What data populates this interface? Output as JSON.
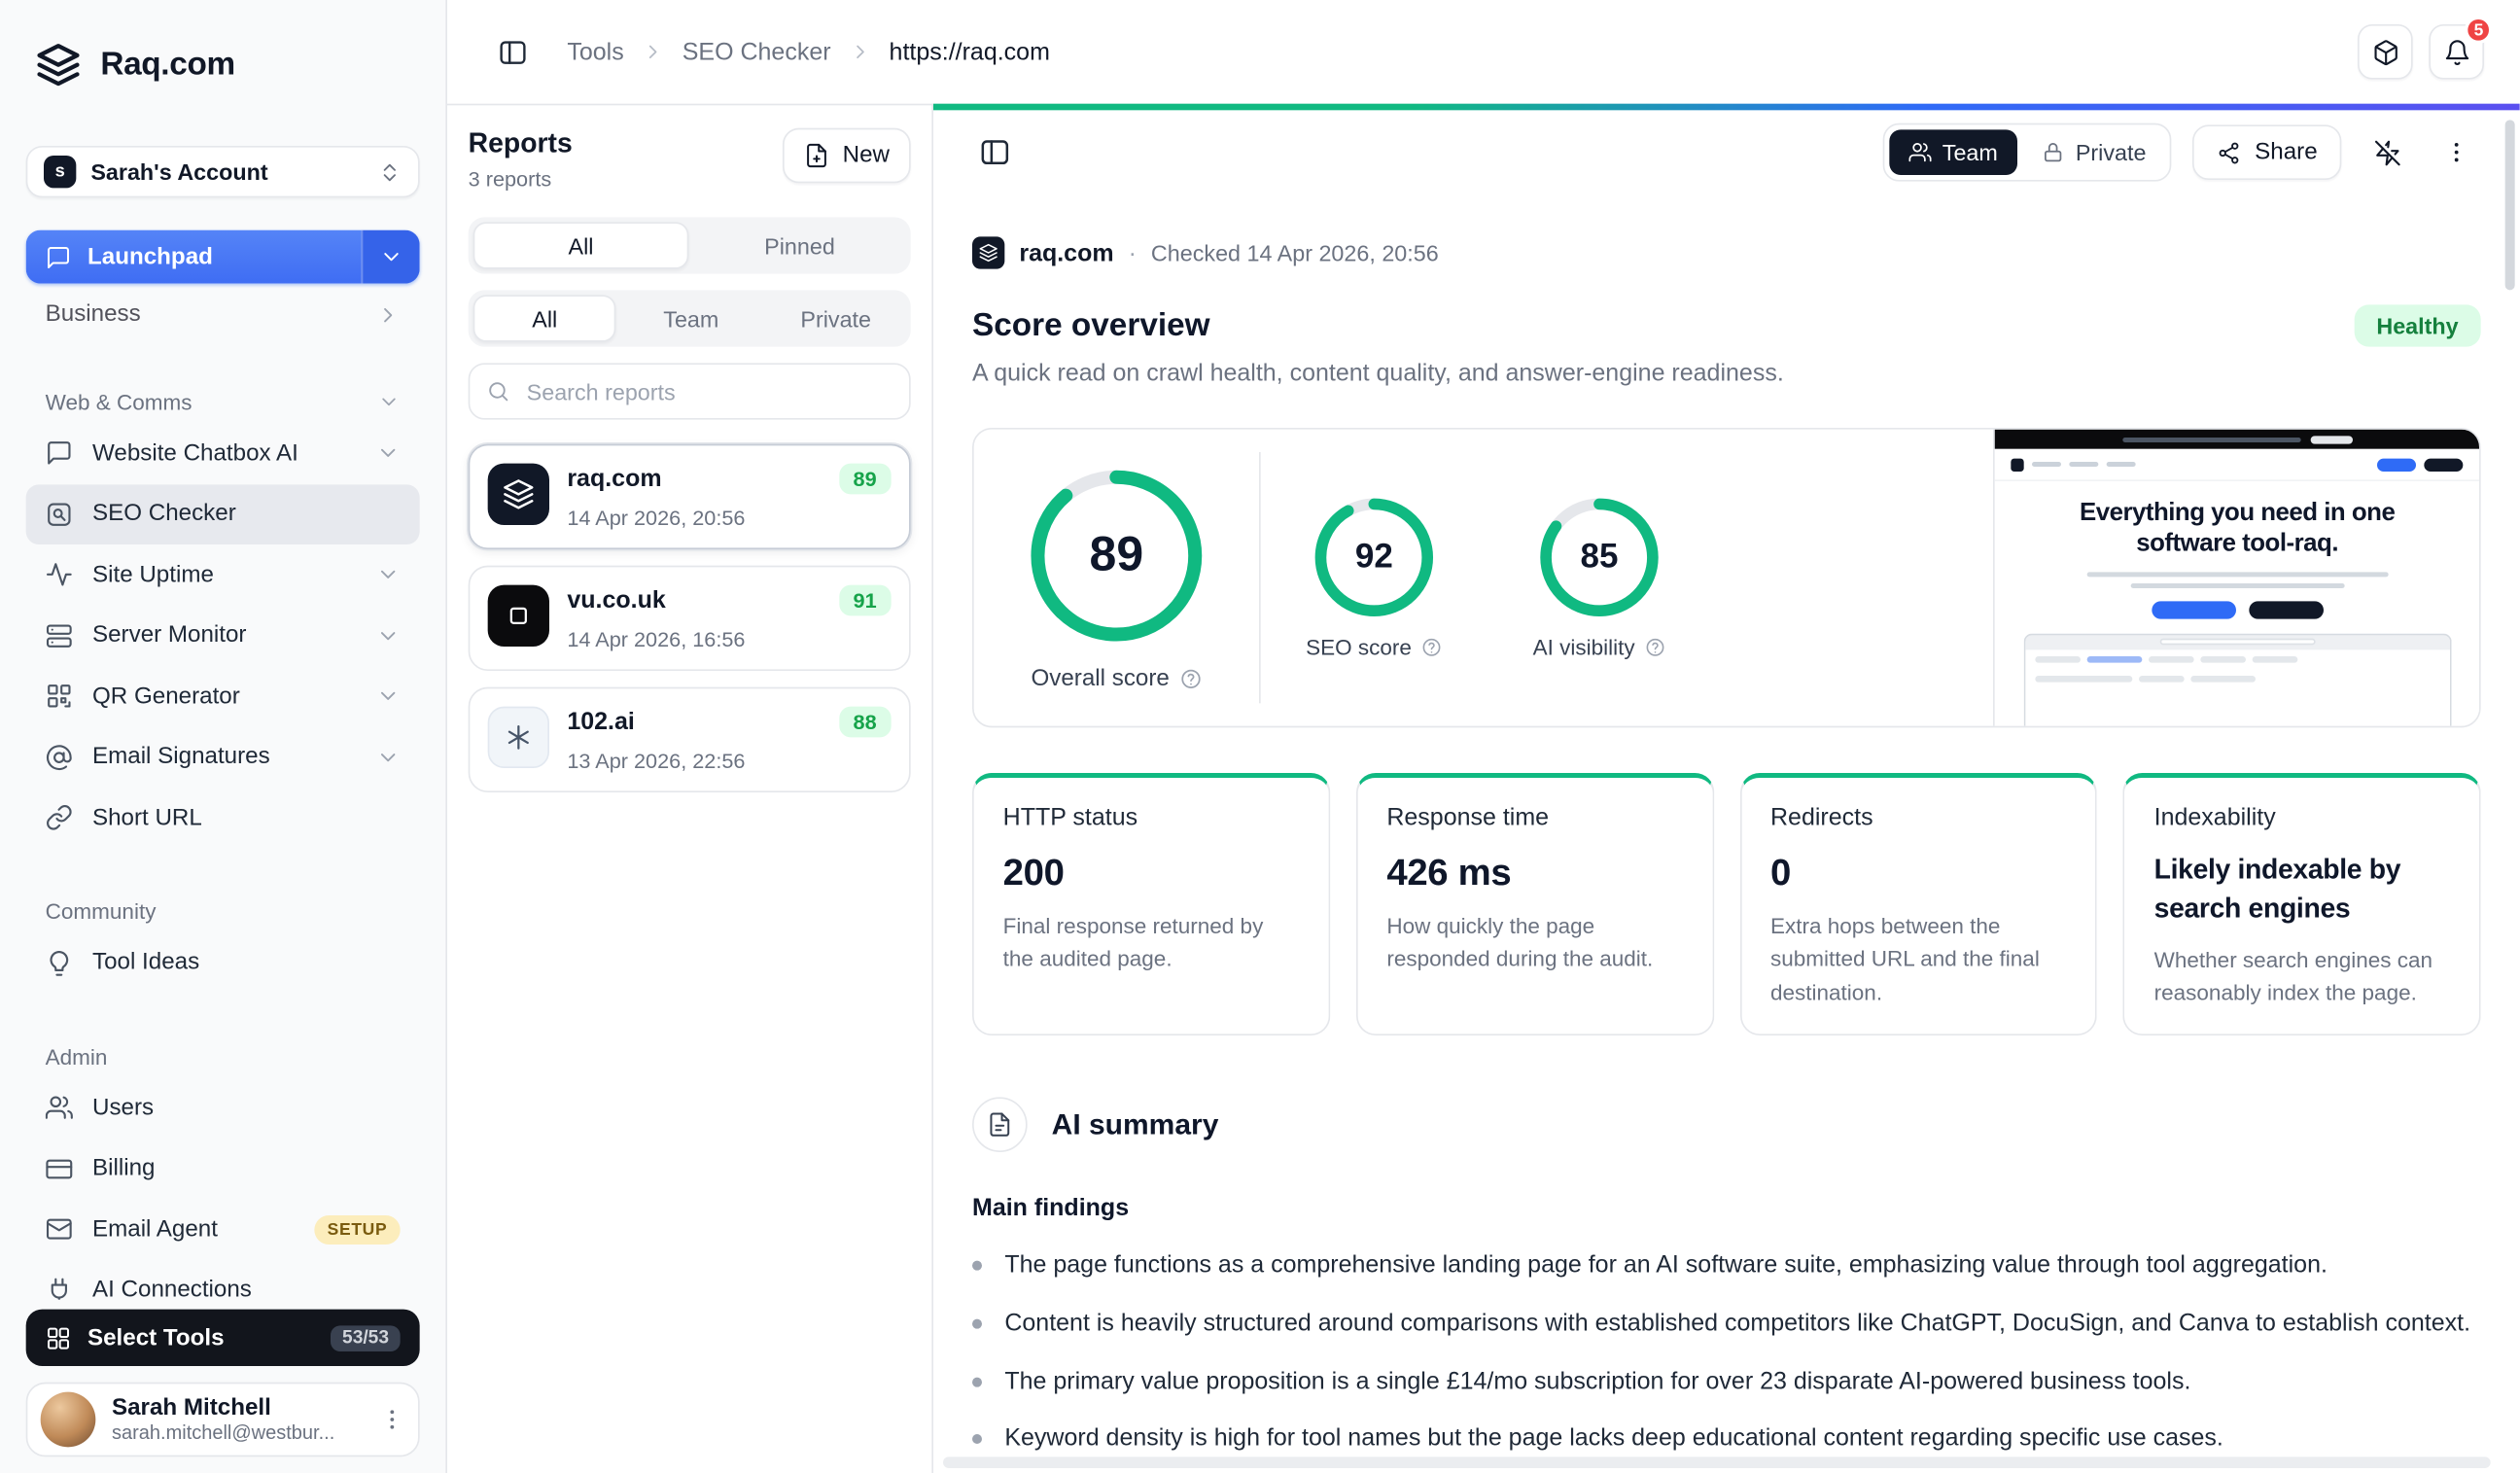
{
  "brand": {
    "name": "Raq.com"
  },
  "sidebar": {
    "account": {
      "initial": "s",
      "name": "Sarah's Account"
    },
    "launchpad_label": "Launchpad",
    "business_label": "Business",
    "sections": {
      "web_comms": "Web & Comms",
      "community": "Community",
      "admin": "Admin"
    },
    "tools": [
      {
        "label": "Website Chatbox AI",
        "icon": "chat-icon"
      },
      {
        "label": "SEO Checker",
        "icon": "seo-search-icon"
      },
      {
        "label": "Site Uptime",
        "icon": "pulse-icon"
      },
      {
        "label": "Server Monitor",
        "icon": "server-icon"
      },
      {
        "label": "QR Generator",
        "icon": "qr-icon"
      },
      {
        "label": "Email Signatures",
        "icon": "at-sign-icon"
      },
      {
        "label": "Short URL",
        "icon": "link-icon"
      }
    ],
    "community_items": [
      {
        "label": "Tool Ideas",
        "icon": "lightbulb-icon"
      }
    ],
    "admin_items": [
      {
        "label": "Users",
        "icon": "users-icon"
      },
      {
        "label": "Billing",
        "icon": "credit-card-icon"
      },
      {
        "label": "Email Agent",
        "icon": "mail-icon",
        "badge": "SETUP"
      },
      {
        "label": "AI Connections",
        "icon": "plug-icon"
      }
    ],
    "select_tools": {
      "label": "Select Tools",
      "count": "53/53"
    },
    "user": {
      "name": "Sarah Mitchell",
      "email": "sarah.mitchell@westbur..."
    }
  },
  "header": {
    "breadcrumbs": [
      "Tools",
      "SEO Checker",
      "https://raq.com"
    ],
    "notification_count": "5"
  },
  "reports_panel": {
    "title": "Reports",
    "count_label": "3 reports",
    "new_label": "New",
    "filter_tabs": [
      "All",
      "Pinned"
    ],
    "scope_tabs": [
      "All",
      "Team",
      "Private"
    ],
    "search_placeholder": "Search reports",
    "reports": [
      {
        "name": "raq.com",
        "score": "89",
        "date": "14 Apr 2026, 20:56"
      },
      {
        "name": "vu.co.uk",
        "score": "91",
        "date": "14 Apr 2026, 16:56"
      },
      {
        "name": "102.ai",
        "score": "88",
        "date": "13 Apr 2026, 22:56"
      }
    ]
  },
  "main": {
    "toolbar": {
      "team_label": "Team",
      "private_label": "Private",
      "share_label": "Share"
    },
    "meta": {
      "site": "raq.com",
      "separator": "·",
      "checked_label": "Checked 14 Apr 2026, 20:56"
    },
    "score_overview": {
      "title": "Score overview",
      "status_badge": "Healthy",
      "subtitle": "A quick read on crawl health, content quality, and answer-engine readiness.",
      "scores": [
        {
          "value": 89,
          "label": "Overall score"
        },
        {
          "value": 92,
          "label": "SEO score"
        },
        {
          "value": 85,
          "label": "AI visibility"
        }
      ],
      "preview_headline": "Everything you need in one software tool-raq."
    },
    "metrics": [
      {
        "title": "HTTP status",
        "value": "200",
        "description": "Final response returned by the audited page."
      },
      {
        "title": "Response time",
        "value": "426 ms",
        "description": "How quickly the page responded during the audit."
      },
      {
        "title": "Redirects",
        "value": "0",
        "description": "Extra hops between the submitted URL and the final destination."
      },
      {
        "title": "Indexability",
        "value": "Likely indexable by search engines",
        "description": "Whether search engines can reasonably index the page."
      }
    ],
    "ai_summary": {
      "title": "AI summary",
      "subtitle": "Main findings",
      "bullets": [
        "The page functions as a comprehensive landing page for an AI software suite, emphasizing value through tool aggregation.",
        "Content is heavily structured around comparisons with established competitors like ChatGPT, DocuSign, and Canva to establish context.",
        "The primary value proposition is a single £14/mo subscription for over 23 disparate AI-powered business tools.",
        "Keyword density is high for tool names but the page lacks deep educational content regarding specific use cases."
      ]
    }
  },
  "colors": {
    "accent_green": "#10b981",
    "accent_blue": "#3b82f6",
    "score_badge_bg": "#dcfce7",
    "score_badge_text": "#16a34a",
    "notification_red": "#ef4444"
  }
}
